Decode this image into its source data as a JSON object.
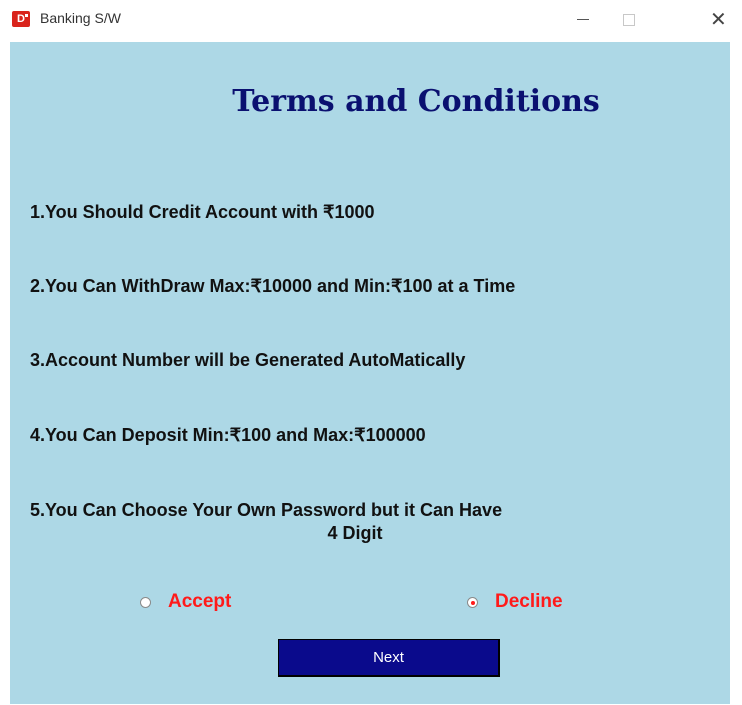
{
  "window": {
    "title": "Banking S/W",
    "icon": "app-icon",
    "controls": [
      "minimize-icon",
      "maximize-icon",
      "close-icon"
    ]
  },
  "heading": "Terms and Conditions",
  "terms": [
    "1.You Should Credit Account with ₹1000",
    "2.You Can WithDraw Max:₹10000 and Min:₹100 at a Time",
    "3.Account Number will be Generated AutoMatically",
    "4.You Can Deposit Min:₹100 and Max:₹100000",
    "5.You Can Choose Your Own Password but it Can Have",
    "4 Digit"
  ],
  "options": {
    "accept_label": "Accept",
    "decline_label": "Decline",
    "selected": "Decline"
  },
  "next_label": "Next",
  "colors": {
    "panel_bg": "#add8e6",
    "heading": "#0a1070",
    "radio_label": "#ff1a1a",
    "button_bg": "#0a0a8c"
  }
}
